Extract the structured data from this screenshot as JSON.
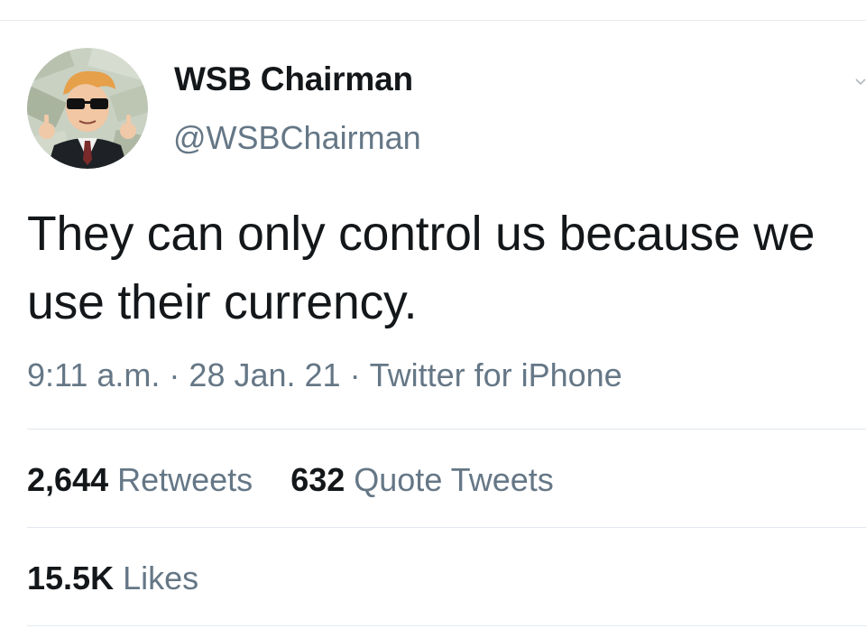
{
  "user": {
    "display_name": "WSB Chairman",
    "handle": "@WSBChairman",
    "avatar_icon": "wsb-chairman-avatar-icon"
  },
  "tweet": {
    "text": "They can only control us because we use their currency."
  },
  "meta": {
    "time": "9:11 a.m.",
    "separator": "·",
    "date": "28 Jan. 21",
    "source": "Twitter for iPhone"
  },
  "stats": {
    "retweets": {
      "value": "2,644",
      "label": "Retweets"
    },
    "quote_tweets": {
      "value": "632",
      "label": "Quote Tweets"
    },
    "likes": {
      "value": "15.5K",
      "label": "Likes"
    }
  },
  "colors": {
    "text_primary": "#14171a",
    "text_secondary": "#657786",
    "divider": "#e1e8ed",
    "background": "#ffffff"
  }
}
